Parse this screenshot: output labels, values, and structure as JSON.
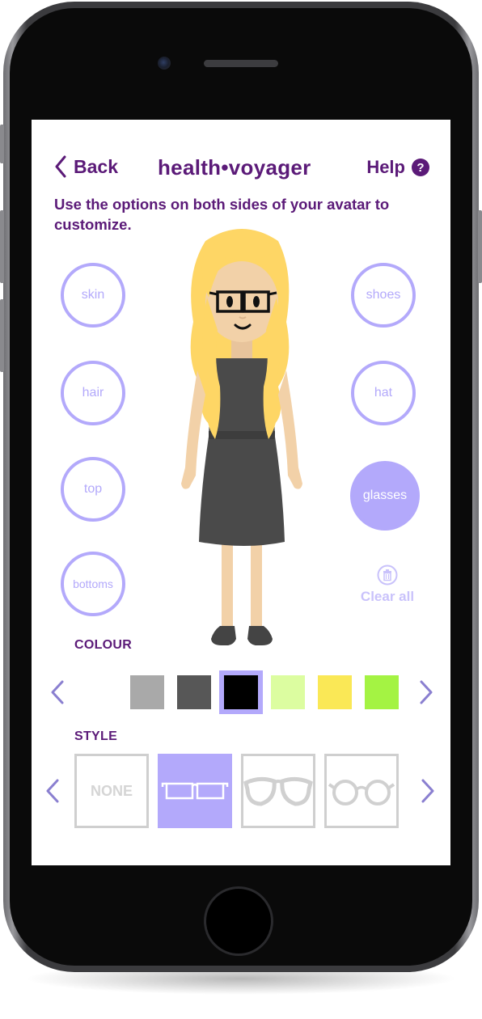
{
  "header": {
    "back_label": "Back",
    "title": "health•voyager",
    "help_label": "Help",
    "help_icon_glyph": "?"
  },
  "instructions": "Use the options on both sides of your avatar to customize.",
  "options": {
    "left": [
      {
        "label": "skin",
        "active": false
      },
      {
        "label": "hair",
        "active": false
      },
      {
        "label": "top",
        "active": false
      },
      {
        "label": "bottoms",
        "active": false
      }
    ],
    "right": [
      {
        "label": "shoes",
        "active": false
      },
      {
        "label": "hat",
        "active": false
      },
      {
        "label": "glasses",
        "active": true
      }
    ],
    "clear_all_label": "Clear all",
    "clear_all_icon": "trash-icon"
  },
  "colour": {
    "label": "COLOUR",
    "swatches": [
      {
        "hex": "#a9a9a9",
        "selected": false
      },
      {
        "hex": "#575757",
        "selected": false
      },
      {
        "hex": "#000000",
        "selected": true
      },
      {
        "hex": "#dcfda0",
        "selected": false
      },
      {
        "hex": "#fae856",
        "selected": false
      },
      {
        "hex": "#a4f343",
        "selected": false
      }
    ],
    "prev_icon": "chevron-left-icon",
    "next_icon": "chevron-right-icon"
  },
  "style": {
    "label": "STYLE",
    "items": [
      {
        "name": "none",
        "label": "NONE",
        "selected": false
      },
      {
        "name": "rectangular-glasses",
        "label": "",
        "selected": true
      },
      {
        "name": "cat-eye-glasses",
        "label": "",
        "selected": false
      },
      {
        "name": "round-glasses",
        "label": "",
        "selected": false
      }
    ],
    "prev_icon": "chevron-left-icon",
    "next_icon": "chevron-right-icon"
  },
  "colors": {
    "primary": "#5b1a78",
    "accent": "#b3a9fb"
  }
}
